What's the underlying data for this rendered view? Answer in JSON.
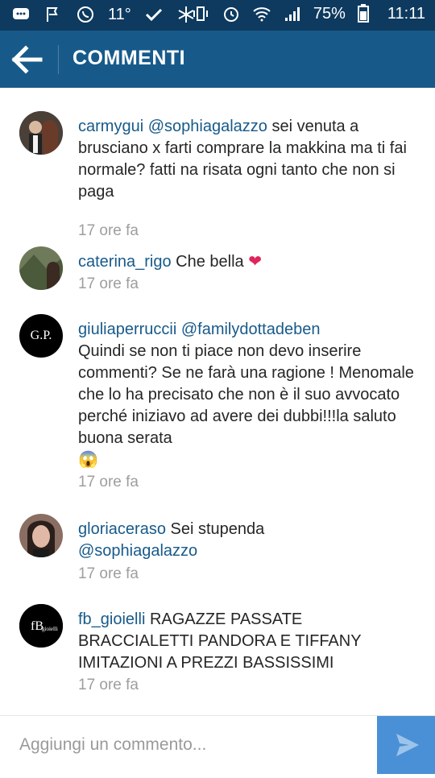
{
  "statusbar": {
    "temperature": "11°",
    "battery": "75%",
    "time": "11:11"
  },
  "header": {
    "title": "COMMENTI"
  },
  "comments": [
    {
      "user": "carmygui",
      "mention": "@sophiagalazzo",
      "text": " sei venuta a brusciano x farti comprare la makkina ma ti fai normale? fatti na risata ogni tanto che non si paga",
      "time": "17 ore fa"
    },
    {
      "user": "caterina_rigo",
      "text": " Che bella ",
      "emoji": "❤",
      "time": "17 ore fa"
    },
    {
      "user": "giuliaperruccii",
      "mention": "@familydottadeben",
      "text": "Quindi se non ti piace non devo inserire commenti? Se ne farà una ragione ! Menomale che lo ha precisato che non è il suo avvocato perché iniziavo ad avere dei dubbi!!!la saluto buona serata",
      "emoji": "😱",
      "time": "17 ore fa",
      "avatar_text": "G.P."
    },
    {
      "user": "gloriaceraso",
      "text": " Sei stupenda ",
      "mention": "@sophiagalazzo",
      "time": "17 ore fa"
    },
    {
      "user": "fb_gioielli",
      "text": " RAGAZZE PASSATE BRACCIALETTI PANDORA E TIFFANY IMITAZIONI A PREZZI BASSISSIMI",
      "time": "17 ore fa"
    }
  ],
  "input": {
    "placeholder": "Aggiungi un commento..."
  },
  "colors": {
    "statusbar": "#0e3a5f",
    "appbar": "#175a8a",
    "link": "#175a8a",
    "send": "#4a90d6"
  }
}
